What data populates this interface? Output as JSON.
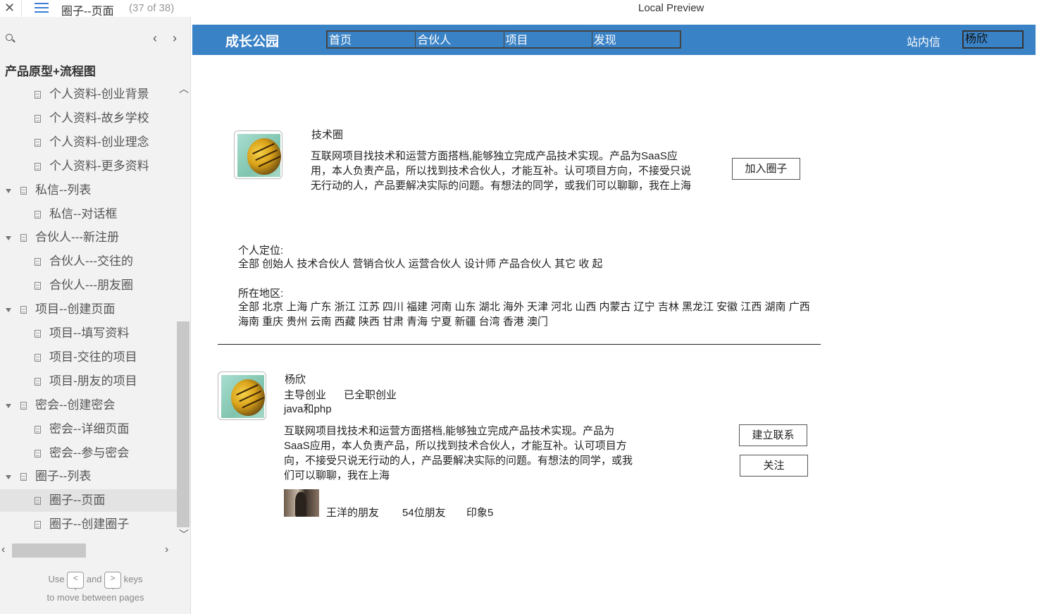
{
  "topbar": {
    "close_icon": "close-icon",
    "menu_icon": "hamburger-menu-icon",
    "page_name": "圈子--页面",
    "page_count": "(37 of 38)",
    "app_title": "Local Preview"
  },
  "sidebar": {
    "root_label": "产品原型+流程图",
    "items": [
      {
        "label": "个人资料-创业背景",
        "level": 2
      },
      {
        "label": "个人资料-故乡学校",
        "level": 2
      },
      {
        "label": "个人资料-创业理念",
        "level": 2
      },
      {
        "label": "个人资料-更多资料",
        "level": 2
      },
      {
        "label": "私信--列表",
        "level": 1
      },
      {
        "label": "私信--对话框",
        "level": 2
      },
      {
        "label": "合伙人---新注册",
        "level": 1
      },
      {
        "label": "合伙人---交往的",
        "level": 2
      },
      {
        "label": "合伙人---朋友圈",
        "level": 2
      },
      {
        "label": "项目--创建页面",
        "level": 1
      },
      {
        "label": "项目--填写资料",
        "level": 2
      },
      {
        "label": "项目-交往的项目",
        "level": 2
      },
      {
        "label": "项目-朋友的项目",
        "level": 2
      },
      {
        "label": "密会--创建密会",
        "level": 1
      },
      {
        "label": "密会--详细页面",
        "level": 2
      },
      {
        "label": "密会--参与密会",
        "level": 2
      },
      {
        "label": "圈子--列表",
        "level": 1
      },
      {
        "label": "圈子--页面",
        "level": 2,
        "selected": true
      },
      {
        "label": "圈子--创建圈子",
        "level": 2
      }
    ],
    "hint_use": "Use",
    "hint_and": "and",
    "hint_keys": "keys",
    "hint_line2": "to move between pages",
    "key_prev": "<\n,",
    "key_next": ">\n."
  },
  "navbar": {
    "brand": "成长公园",
    "tabs": [
      "首页",
      "合伙人",
      "项目",
      "发现"
    ],
    "messages": "站内信",
    "user": "杨欣"
  },
  "circle": {
    "title": "技术圈",
    "description": "互联网项目找技术和运营方面搭档,能够独立完成产品技术实现。产品为SaaS应用，本人负责产品，所以找到技术合伙人，才能互补。认可项目方向，不接受只说无行动的人，产品要解决实际的问题。有想法的同学，或我们可以聊聊，我在上海",
    "join_button": "加入圈子"
  },
  "filters": {
    "position_label": "个人定位:",
    "position_options": "全部 创始人 技术合伙人 营销合伙人 运营合伙人 设计师 产品合伙人 其它 收 起",
    "region_label": "所在地区:",
    "region_options": "全部 北京 上海 广东 浙江 江苏 四川 福建 河南 山东 湖北 海外 天津 河北 山西 内蒙古 辽宁 吉林 黑龙江 安徽 江西 湖南 广西 海南 重庆 贵州 云南 西藏 陕西 甘肃 青海 宁夏 新疆 台湾 香港 澳门"
  },
  "member": {
    "name": "杨欣",
    "role": "主导创业",
    "status": "已全职创业",
    "skills": "java和php",
    "description": "互联网项目找技术和运营方面搭档,能够独立完成产品技术实现。产品为SaaS应用，本人负责产品，所以找到技术合伙人，才能互补。认可项目方向，不接受只说无行动的人，产品要解决实际的问题。有想法的同学，或我们可以聊聊，我在上海",
    "connect_button": "建立联系",
    "follow_button": "关注",
    "friend_of": "王洋的朋友",
    "friend_count": "54位朋友",
    "impression": "印象5"
  }
}
